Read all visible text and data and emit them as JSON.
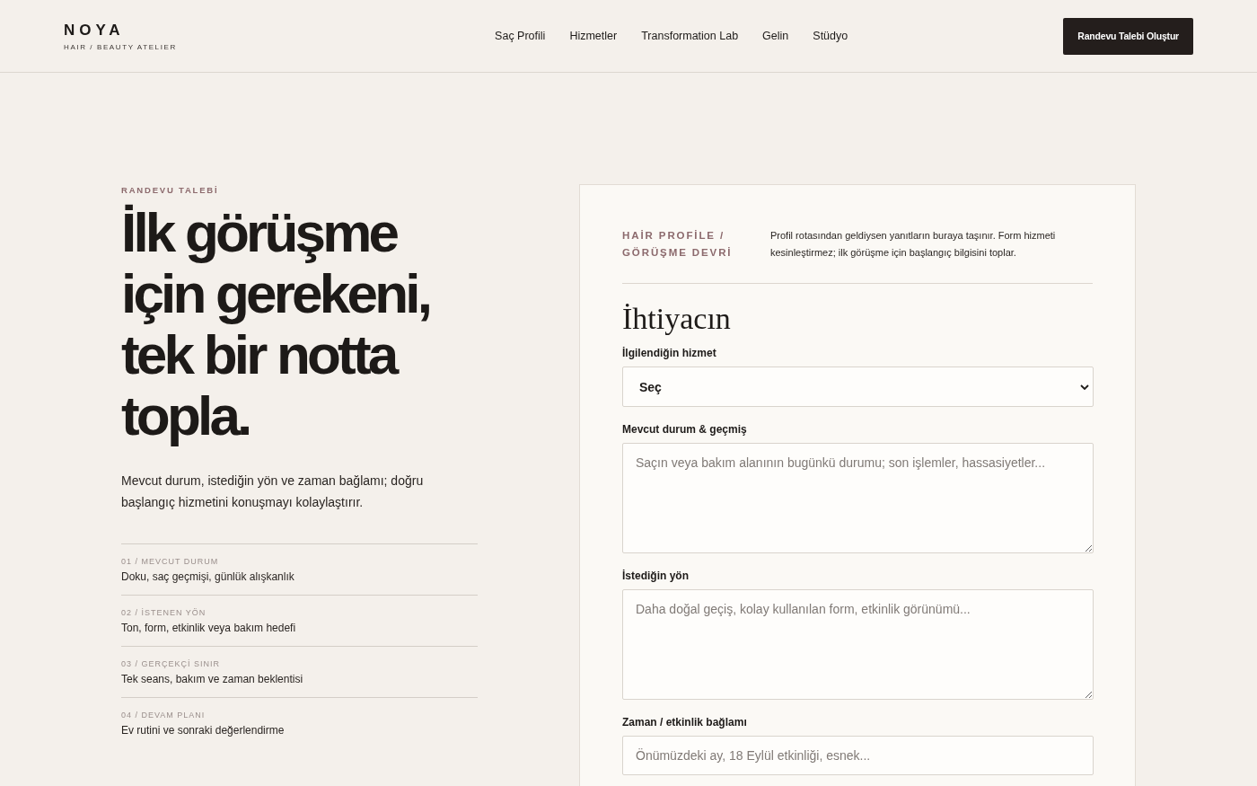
{
  "header": {
    "brand": "NOYA",
    "tagline": "HAIR / BEAUTY ATELIER",
    "nav": [
      "Saç Profili",
      "Hizmetler",
      "Transformation Lab",
      "Gelin",
      "Stüdyo"
    ],
    "cta": "Randevu Talebi Oluştur"
  },
  "intro": {
    "eyebrow": "RANDEVU TALEBİ",
    "lines": [
      "İlk görüşme",
      "için gerekeni,",
      "tek bir notta",
      "topla."
    ],
    "lead": "Mevcut durum, istediğin yön ve zaman bağlamı; doğru başlangıç hizmetini konuşmayı kolaylaştırır.",
    "steps": [
      {
        "label": "01 / MEVCUT DURUM",
        "text": "Doku, saç geçmişi, günlük alışkanlık"
      },
      {
        "label": "02 / İSTENEN YÖN",
        "text": "Ton, form, etkinlik veya bakım hedefi"
      },
      {
        "label": "03 / GERÇEKÇİ SINIR",
        "text": "Tek seans, bakım ve zaman beklentisi"
      },
      {
        "label": "04 / DEVAM PLANI",
        "text": "Ev rutini ve sonraki değerlendirme"
      }
    ]
  },
  "form": {
    "eyebrow": "HAİR PROFİLE / GÖRÜŞME DEVRİ",
    "note": "Profil rotasından geldiysen yanıtların buraya taşınır. Form hizmeti kesinleştirmez; ilk görüşme için başlangıç bilgisini toplar.",
    "section": "İhtiyacın",
    "fields": [
      {
        "kind": "select",
        "label": "İlgilendiğin hizmet",
        "value": "Seç"
      },
      {
        "kind": "textarea",
        "label": "Mevcut durum & geçmiş",
        "placeholder": "Saçın veya bakım alanının bugünkü durumu; son işlemler, hassasiyetler..."
      },
      {
        "kind": "textarea",
        "label": "İstediğin yön",
        "placeholder": "Daha doğal geçiş, kolay kullanılan form, etkinlik görünümü..."
      },
      {
        "kind": "input",
        "label": "Zaman / etkinlik bağlamı",
        "placeholder": "Önümüzdeki ay, 18 Eylül etkinliği, esnek..."
      }
    ]
  }
}
